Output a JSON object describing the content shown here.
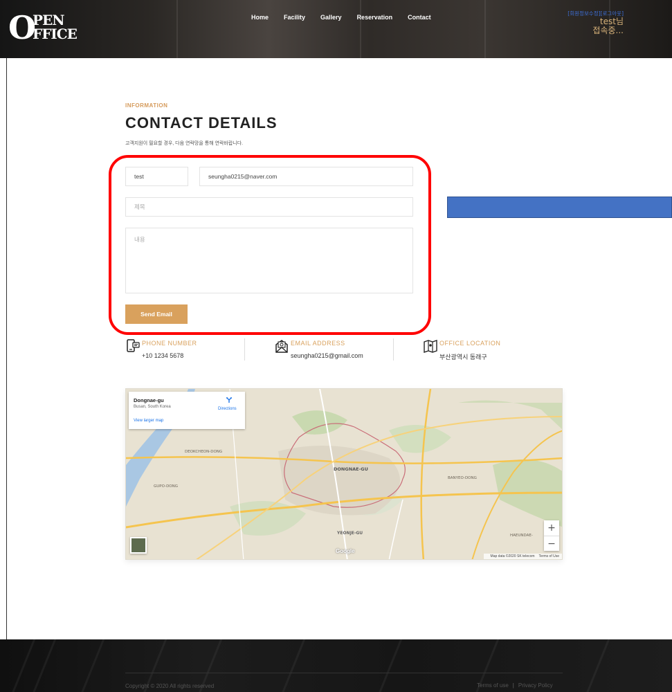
{
  "header": {
    "logo_top": "PEN",
    "logo_bottom": "FFICE",
    "logo_o": "O",
    "nav": [
      "Home",
      "Facility",
      "Gallery",
      "Reservation",
      "Contact"
    ],
    "user_edit_link": "[회원정보수정]",
    "user_logout_link": "[로그아웃]",
    "user_name": "test님",
    "user_status": "접속중..."
  },
  "contact": {
    "eyebrow": "INFORMATION",
    "title": "CONTACT DETAILS",
    "subtitle": "고객지원이 필요할 경우, 다음 연락망을 통해 연락바랍니다."
  },
  "form": {
    "name_value": "test",
    "email_value": "seungha0215@naver.com",
    "subject_placeholder": "제목",
    "body_placeholder": "내용",
    "send_label": "Send Email"
  },
  "info": {
    "phone_label": "PHONE NUMBER",
    "phone_value": "+10 1234 5678",
    "email_label": "EMAIL ADDRESS",
    "email_value": "seungha0215@gmail.com",
    "location_label": "OFFICE LOCATION",
    "location_value": "부산광역시 동래구"
  },
  "map": {
    "place_name": "Dongnae-gu",
    "place_region": "Busan, South Korea",
    "directions": "Directions",
    "larger_map": "View larger map",
    "zoom_in": "+",
    "zoom_out": "−",
    "google": "Google",
    "map_data": "Map data ©2020 SK telecom",
    "terms": "Terms of Use",
    "labels": {
      "deokcheon": "DEOKCHEON-DONG",
      "dongnae": "DONGNAE-GU",
      "gupo": "GUPO-DONG",
      "banyeo": "BANYEO-DONG",
      "yeonje": "YEONJE-GU",
      "haeundae": "HAEUNDAE-"
    }
  },
  "footer": {
    "copyright": "Copyright © 2020 All rights reserved",
    "terms": "Terms of use",
    "separator": "|",
    "privacy": "Privacy Policy"
  },
  "colors": {
    "accent": "#d9a15d",
    "highlight": "#ff0000",
    "overlay_bar": "#4472c4"
  }
}
